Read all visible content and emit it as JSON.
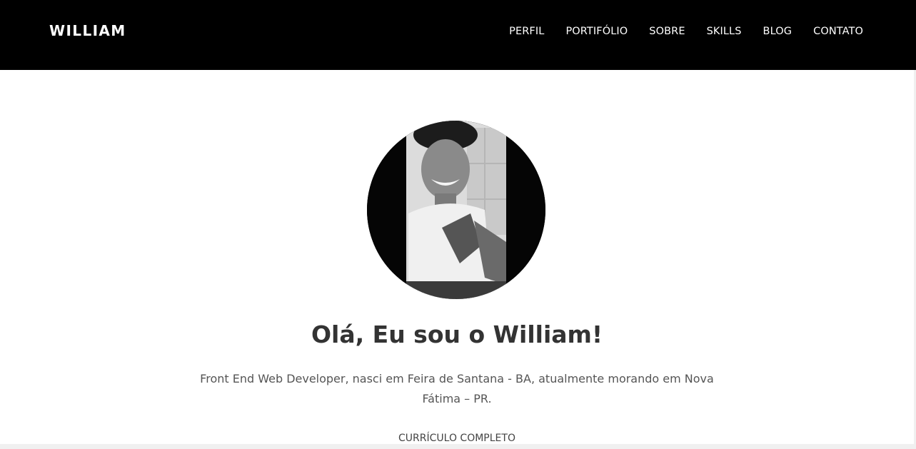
{
  "header": {
    "brand": "WILLIAM",
    "nav": [
      {
        "label": "PERFIL"
      },
      {
        "label": "PORTIFÓLIO"
      },
      {
        "label": "SOBRE"
      },
      {
        "label": "SKILLS"
      },
      {
        "label": "BLOG"
      },
      {
        "label": "CONTATO"
      }
    ]
  },
  "hero": {
    "avatar_icon": "profile-photo",
    "title": "Olá, Eu sou o William!",
    "description": "Front End Web Developer, nasci em Feira de Santana - BA, atualmente morando em Nova Fátima – PR.",
    "cv_link": "CURRÍCULO COMPLETO"
  },
  "colors": {
    "header_bg": "#000000",
    "title": "#333333",
    "text": "#555555"
  }
}
